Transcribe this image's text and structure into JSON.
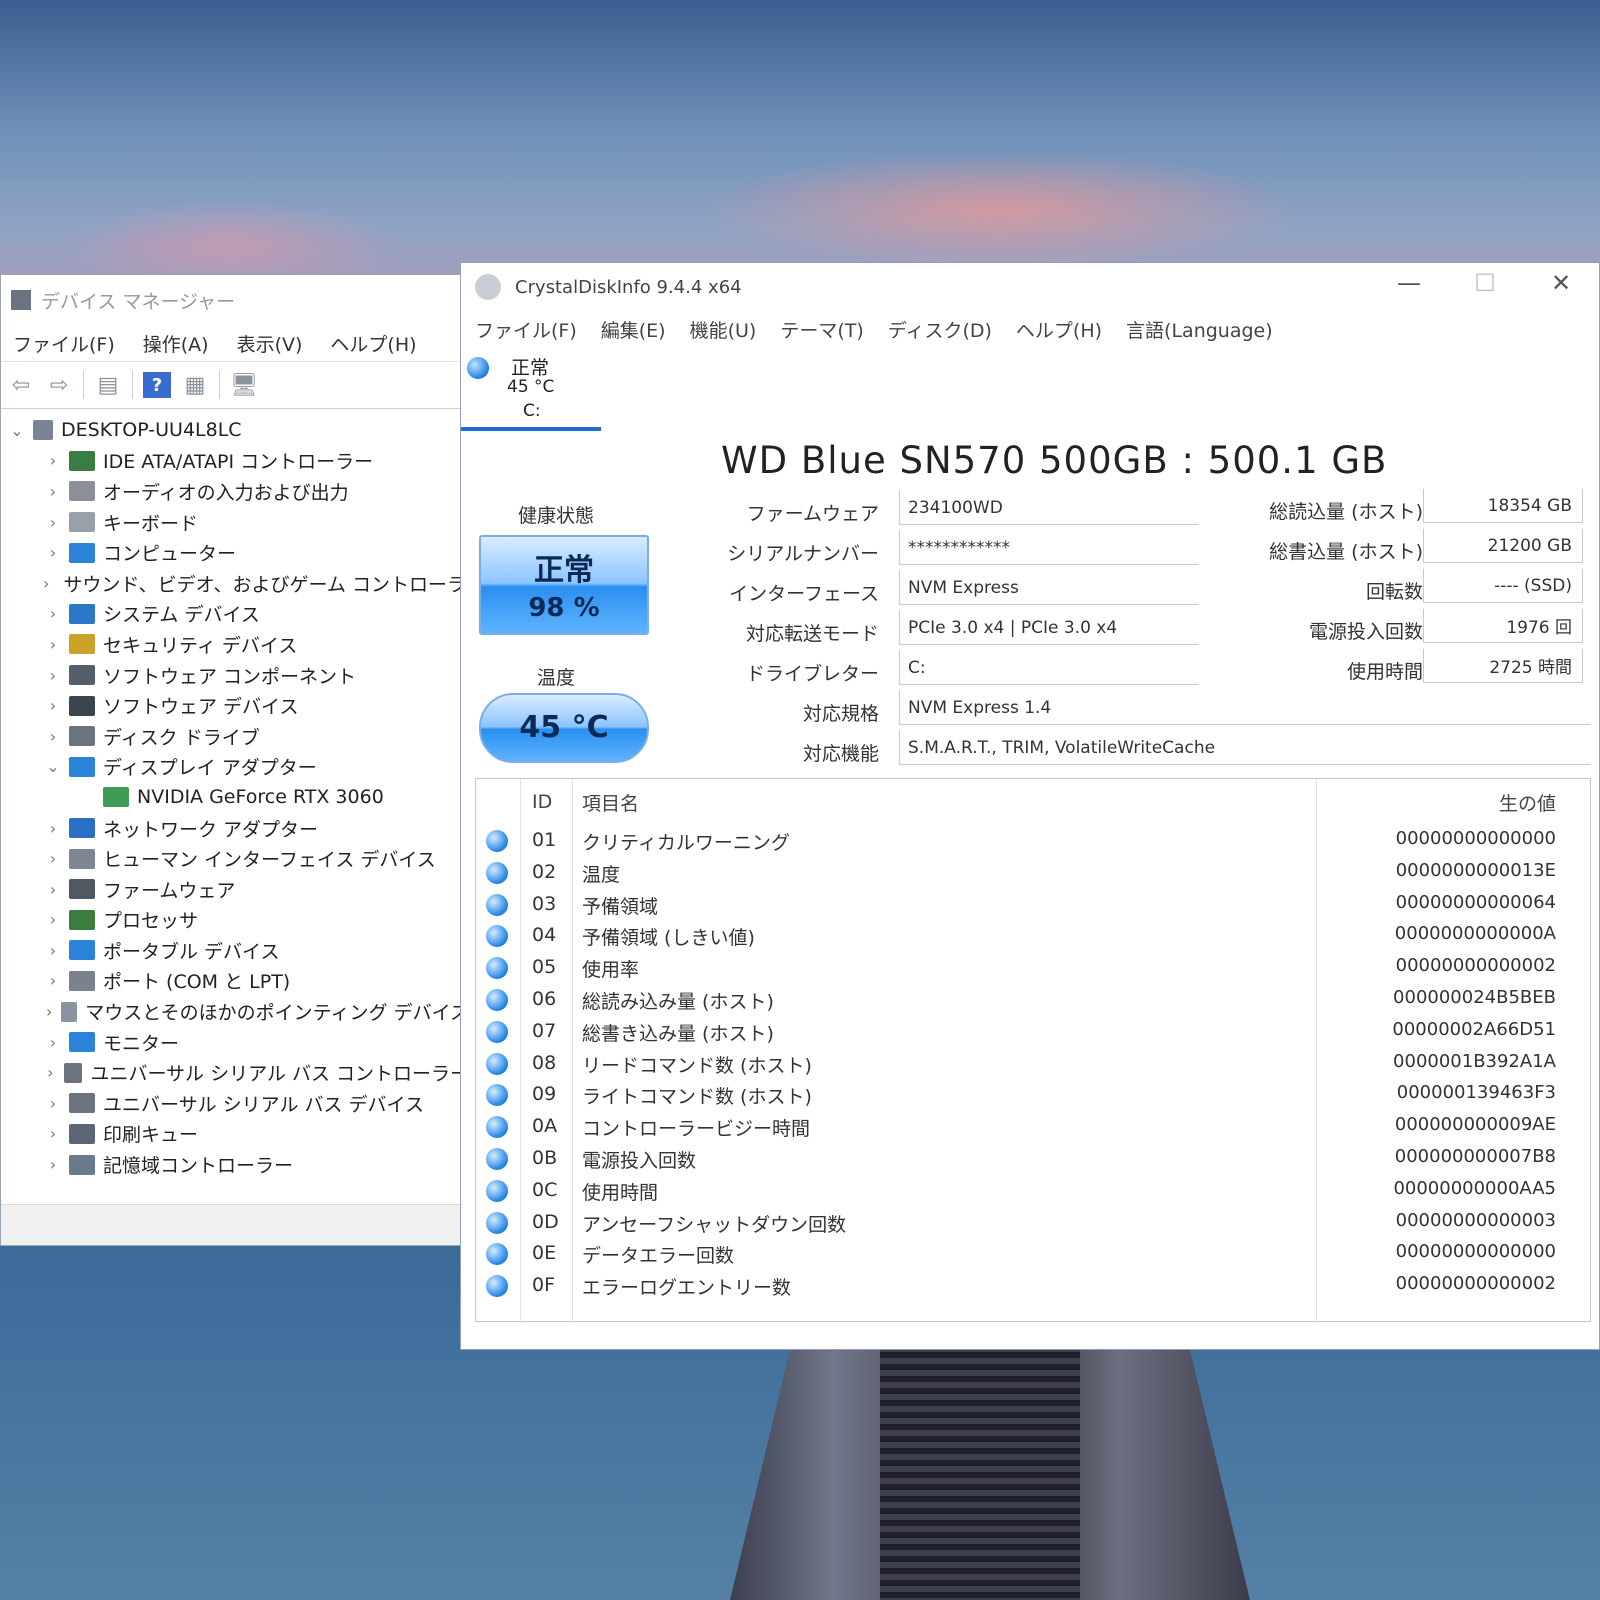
{
  "device_manager": {
    "title": "デバイス マネージャー",
    "menu": [
      "ファイル(F)",
      "操作(A)",
      "表示(V)",
      "ヘルプ(H)"
    ],
    "root": "DESKTOP-UU4L8LC",
    "items": [
      {
        "label": "IDE ATA/ATAPI コントローラー",
        "icon": "ide-controller-icon",
        "expanded": false
      },
      {
        "label": "オーディオの入力および出力",
        "icon": "speaker-icon",
        "expanded": false
      },
      {
        "label": "キーボード",
        "icon": "keyboard-icon",
        "expanded": false
      },
      {
        "label": "コンピューター",
        "icon": "computer-icon",
        "expanded": false
      },
      {
        "label": "サウンド、ビデオ、およびゲーム コントローラー",
        "icon": "speaker-icon",
        "expanded": false
      },
      {
        "label": "システム デバイス",
        "icon": "folder-icon",
        "expanded": false
      },
      {
        "label": "セキュリティ デバイス",
        "icon": "security-key-icon",
        "expanded": false
      },
      {
        "label": "ソフトウェア コンポーネント",
        "icon": "puzzle-icon",
        "expanded": false
      },
      {
        "label": "ソフトウェア デバイス",
        "icon": "device-icon",
        "expanded": false
      },
      {
        "label": "ディスク ドライブ",
        "icon": "disk-icon",
        "expanded": false
      },
      {
        "label": "ディスプレイ アダプター",
        "icon": "monitor-icon",
        "expanded": true
      },
      {
        "label": "NVIDIA GeForce RTX 3060",
        "icon": "gpu-icon",
        "child": true
      },
      {
        "label": "ネットワーク アダプター",
        "icon": "network-icon",
        "expanded": false
      },
      {
        "label": "ヒューマン インターフェイス デバイス",
        "icon": "hid-icon",
        "expanded": false
      },
      {
        "label": "ファームウェア",
        "icon": "chip-icon",
        "expanded": false
      },
      {
        "label": "プロセッサ",
        "icon": "processor-icon",
        "expanded": false
      },
      {
        "label": "ポータブル デバイス",
        "icon": "portable-icon",
        "expanded": false
      },
      {
        "label": "ポート (COM と LPT)",
        "icon": "port-icon",
        "expanded": false
      },
      {
        "label": "マウスとそのほかのポインティング デバイス",
        "icon": "mouse-icon",
        "expanded": false
      },
      {
        "label": "モニター",
        "icon": "monitor-icon",
        "expanded": false
      },
      {
        "label": "ユニバーサル シリアル バス コントローラー",
        "icon": "usb-icon",
        "expanded": false
      },
      {
        "label": "ユニバーサル シリアル バス デバイス",
        "icon": "usb-icon",
        "expanded": false
      },
      {
        "label": "印刷キュー",
        "icon": "printer-icon",
        "expanded": false
      },
      {
        "label": "記憶域コントローラー",
        "icon": "storage-icon",
        "expanded": false
      }
    ]
  },
  "cdi": {
    "title": "CrystalDiskInfo 9.4.4 x64",
    "menu": [
      "ファイル(F)",
      "編集(E)",
      "機能(U)",
      "テーマ(T)",
      "ディスク(D)",
      "ヘルプ(H)",
      "言語(Language)"
    ],
    "disk_tab": {
      "status": "正常",
      "temp": "45 °C",
      "drive": "C:"
    },
    "model": "WD Blue SN570 500GB : 500.1 GB",
    "health_label": "健康状態",
    "health_status": "正常",
    "health_percent": "98 %",
    "temp_label": "温度",
    "temp_value": "45 °C",
    "fields": {
      "firmware": {
        "label": "ファームウェア",
        "value": "234100WD"
      },
      "serial": {
        "label": "シリアルナンバー",
        "value": "************"
      },
      "interface": {
        "label": "インターフェース",
        "value": "NVM Express"
      },
      "transfer": {
        "label": "対応転送モード",
        "value": "PCIe 3.0 x4 | PCIe 3.0 x4"
      },
      "drive_letter": {
        "label": "ドライブレター",
        "value": "C:"
      },
      "standard": {
        "label": "対応規格",
        "value": "NVM Express 1.4"
      },
      "features": {
        "label": "対応機能",
        "value": "S.M.A.R.T., TRIM, VolatileWriteCache"
      }
    },
    "right_fields": {
      "read": {
        "label": "総読込量 (ホスト)",
        "value": "18354 GB"
      },
      "write": {
        "label": "総書込量 (ホスト)",
        "value": "21200 GB"
      },
      "rotation": {
        "label": "回転数",
        "value": "---- (SSD)"
      },
      "power_count": {
        "label": "電源投入回数",
        "value": "1976 回"
      },
      "power_hours": {
        "label": "使用時間",
        "value": "2725 時間"
      }
    },
    "smart_headers": {
      "id": "ID",
      "name": "項目名",
      "raw": "生の値"
    },
    "smart_rows": [
      {
        "id": "01",
        "name": "クリティカルワーニング",
        "raw": "00000000000000"
      },
      {
        "id": "02",
        "name": "温度",
        "raw": "0000000000013E"
      },
      {
        "id": "03",
        "name": "予備領域",
        "raw": "00000000000064"
      },
      {
        "id": "04",
        "name": "予備領域 (しきい値)",
        "raw": "0000000000000A"
      },
      {
        "id": "05",
        "name": "使用率",
        "raw": "00000000000002"
      },
      {
        "id": "06",
        "name": "総読み込み量 (ホスト)",
        "raw": "000000024B5BEB"
      },
      {
        "id": "07",
        "name": "総書き込み量 (ホスト)",
        "raw": "00000002A66D51"
      },
      {
        "id": "08",
        "name": "リードコマンド数 (ホスト)",
        "raw": "0000001B392A1A"
      },
      {
        "id": "09",
        "name": "ライトコマンド数 (ホスト)",
        "raw": "000000139463F3"
      },
      {
        "id": "0A",
        "name": "コントローラービジー時間",
        "raw": "000000000009AE"
      },
      {
        "id": "0B",
        "name": "電源投入回数",
        "raw": "000000000007B8"
      },
      {
        "id": "0C",
        "name": "使用時間",
        "raw": "00000000000AA5"
      },
      {
        "id": "0D",
        "name": "アンセーフシャットダウン回数",
        "raw": "00000000000003"
      },
      {
        "id": "0E",
        "name": "データエラー回数",
        "raw": "00000000000000"
      },
      {
        "id": "0F",
        "name": "エラーログエントリー数",
        "raw": "00000000000002"
      }
    ]
  }
}
